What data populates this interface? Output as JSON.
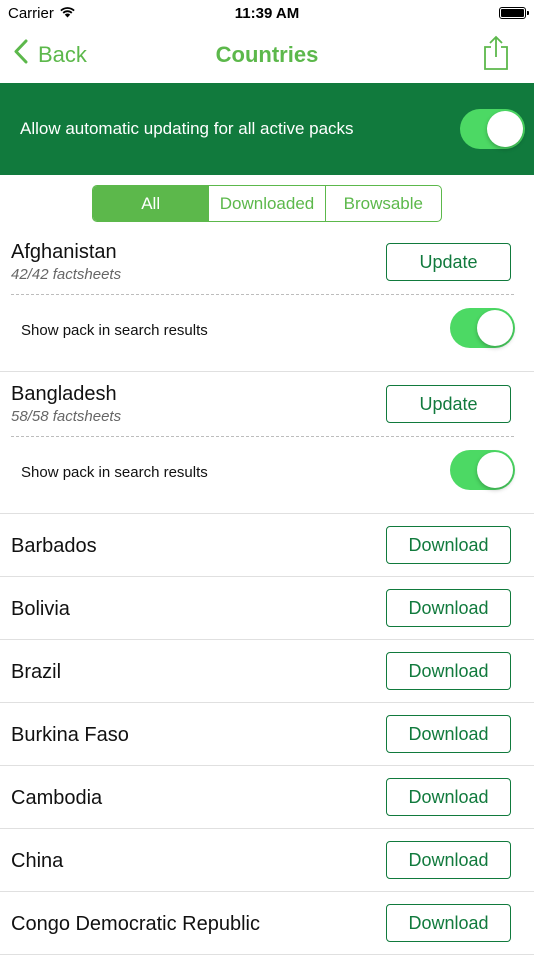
{
  "status_bar": {
    "carrier": "Carrier",
    "time": "11:39 AM"
  },
  "nav": {
    "back_label": "Back",
    "title": "Countries",
    "share_icon": "share-icon"
  },
  "banner": {
    "text": "Allow automatic updating for all active packs",
    "toggle_on": true
  },
  "segments": [
    {
      "label": "All",
      "active": true
    },
    {
      "label": "Downloaded",
      "active": false
    },
    {
      "label": "Browsable",
      "active": false
    }
  ],
  "packs": [
    {
      "name": "Afghanistan",
      "sub": "42/42 factsheets",
      "button": "Update",
      "show_label": "Show pack in search results",
      "toggle_on": true
    },
    {
      "name": "Bangladesh",
      "sub": "58/58 factsheets",
      "button": "Update",
      "show_label": "Show pack in search results",
      "toggle_on": true
    }
  ],
  "rows": [
    {
      "name": "Barbados",
      "button": "Download"
    },
    {
      "name": "Bolivia",
      "button": "Download"
    },
    {
      "name": "Brazil",
      "button": "Download"
    },
    {
      "name": "Burkina Faso",
      "button": "Download"
    },
    {
      "name": "Cambodia",
      "button": "Download"
    },
    {
      "name": "China",
      "button": "Download"
    },
    {
      "name": "Congo Democratic Republic",
      "button": "Download"
    }
  ],
  "colors": {
    "brand_green": "#5cb84b",
    "dark_green": "#117a3d",
    "toggle_green": "#4cd964"
  }
}
